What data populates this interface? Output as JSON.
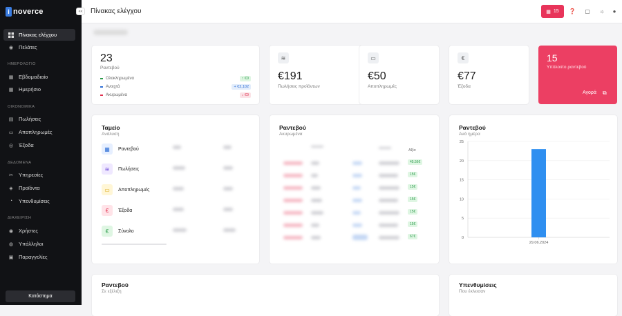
{
  "brand": {
    "logo_letter": "i",
    "logo_text": "noverce",
    "collapse_label": "<<"
  },
  "sidebar": {
    "items": [
      {
        "label": "Πίνακας ελέγχου",
        "icon": "grid-icon"
      },
      {
        "label": "Πελάτες",
        "icon": "user-icon"
      },
      {
        "label": "Εβδομαδιαίο",
        "icon": "calendar-week-icon"
      },
      {
        "label": "Ημερήσιο",
        "icon": "calendar-day-icon"
      },
      {
        "label": "Πωλήσεις",
        "icon": "sales-icon"
      },
      {
        "label": "Αποπληρωμές",
        "icon": "repayments-icon"
      },
      {
        "label": "Έξοδα",
        "icon": "expenses-icon"
      },
      {
        "label": "Υπηρεσίες",
        "icon": "services-icon"
      },
      {
        "label": "Προϊόντα",
        "icon": "products-icon"
      },
      {
        "label": "Υπενθυμίσεις",
        "icon": "reminders-icon"
      },
      {
        "label": "Χρήστες",
        "icon": "users-icon"
      },
      {
        "label": "Υπάλληλοι",
        "icon": "employees-icon"
      },
      {
        "label": "Παραγγελίες",
        "icon": "orders-icon"
      }
    ],
    "sections": [
      "ΗΜΕΡΟΛΟΓΙΟ",
      "ΟΙΚΟΝΟΜΙΚΑ",
      "ΔΕΔΟΜΕΝΑ",
      "ΔΙΑΧΕΙΡΙΣΗ"
    ],
    "shop_button": "Κατάστημα"
  },
  "header": {
    "title": "Πίνακας ελέγχου",
    "badge_count": "15"
  },
  "stats": {
    "appointments": {
      "value": "23",
      "label": "Ραντεβού",
      "rows": [
        {
          "label": "Ολοκληρωμένα",
          "amount": "↑ €0"
        },
        {
          "label": "Ανοιχτά",
          "amount": "+ €2,102"
        },
        {
          "label": "Ακυρωμένα",
          "amount": "↓ €0"
        }
      ]
    },
    "product_sales": {
      "value": "€191",
      "label": "Πωλήσεις προϊόντων"
    },
    "repayments": {
      "value": "€50",
      "label": "Αποπληρωμές"
    },
    "expenses": {
      "value": "€77",
      "label": "Έξοδα"
    },
    "remaining": {
      "value": "15",
      "label": "Υπόλοιπο ραντεβού",
      "action": "Αγορά"
    }
  },
  "cashbox": {
    "title": "Ταμείο",
    "subtitle": "Ανάλυση",
    "rows": [
      "Ραντεβού",
      "Πωλήσεις",
      "Αποπληρωμές",
      "Έξοδα",
      "Σύνολο"
    ]
  },
  "cancelled": {
    "title": "Ραντεβού",
    "subtitle": "Ακυρωμένα",
    "value_header": "Αξία",
    "values": [
      "45.56€",
      "15€",
      "15€",
      "15€",
      "15€",
      "15€",
      "67€"
    ]
  },
  "chart_card": {
    "title": "Ραντεβού",
    "subtitle": "Ανά ημέρα"
  },
  "chart_data": {
    "type": "bar",
    "categories": [
      "29.06.2024"
    ],
    "values": [
      23
    ],
    "ylim": [
      0,
      25
    ],
    "yticks": [
      0,
      5,
      10,
      15,
      20,
      25
    ],
    "color": "#2f8ff0",
    "grid": true
  },
  "in_progress": {
    "title": "Ραντεβού",
    "subtitle": "Σε εξέλιξη"
  },
  "reminders": {
    "title": "Υπενθυμίσεις",
    "subtitle": "Που έκλεισαν"
  },
  "colors": {
    "accent": "#e8345a",
    "green": "#2d9c4c",
    "blue": "#2f6fd6",
    "red": "#e0304f"
  }
}
